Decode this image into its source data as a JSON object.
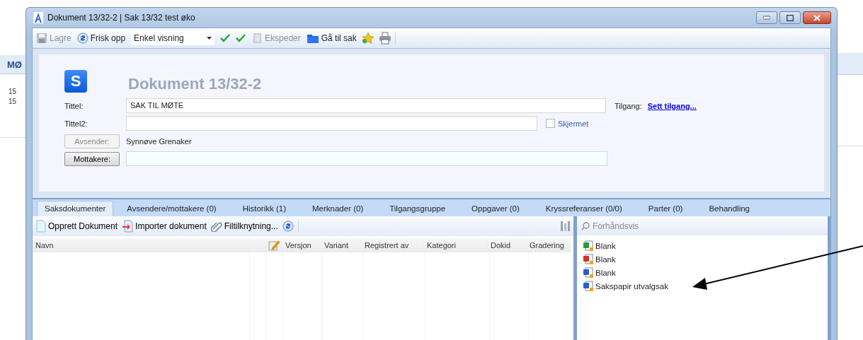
{
  "background_app": {
    "heading": "MØ",
    "lines": [
      "15",
      "15"
    ]
  },
  "window": {
    "title": "Dokument 13/32-2 | Sak 13/32 test øko"
  },
  "toolbar": [
    {
      "kind": "save",
      "label": "Lagre",
      "disabled": true
    },
    {
      "kind": "refresh",
      "label": "Frisk opp",
      "disabled": false
    },
    {
      "kind": "dropdown",
      "value": "Enkel visning"
    },
    {
      "kind": "check"
    },
    {
      "kind": "check"
    },
    {
      "kind": "send",
      "label": "Ekspeder",
      "disabled": true
    },
    {
      "kind": "folder",
      "label": "Gå til sak",
      "disabled": false
    },
    {
      "kind": "star"
    },
    {
      "kind": "print"
    }
  ],
  "form": {
    "heading": "Dokument 13/32-2",
    "badge": "S",
    "title": {
      "label": "Tittel:",
      "value": "SAK TIL MØTE"
    },
    "access": {
      "label": "Tilgang:",
      "link": "Sett tilgang..."
    },
    "title2": {
      "label": "Tittel2:"
    },
    "shielded": {
      "label": "Skjermet",
      "checked": false
    },
    "sender": {
      "button": "Avsender:",
      "disabled": true,
      "value": "Synnøve Grenaker"
    },
    "recipients": {
      "button": "Mottakere:",
      "disabled": false
    }
  },
  "tabs": [
    {
      "label": "Saksdokumenter",
      "selected": true
    },
    {
      "label": "Avsendere/mottakere (0)",
      "selected": false
    },
    {
      "label": "Historikk (1)",
      "selected": false
    },
    {
      "label": "Merknader (0)",
      "selected": false
    },
    {
      "label": "Tilgangsgruppe",
      "selected": false
    },
    {
      "label": "Oppgaver (0)",
      "selected": false
    },
    {
      "label": "Kryssreferanser (0/0)",
      "selected": false
    },
    {
      "label": "Parter (0)",
      "selected": false
    },
    {
      "label": "Behandling",
      "selected": false
    }
  ],
  "documents_toolbar": [
    {
      "kind": "new",
      "label": "Opprett Dokument"
    },
    {
      "kind": "import",
      "label": "Importer dokument"
    },
    {
      "kind": "link",
      "label": "Filtilknytning..."
    },
    {
      "kind": "refresh"
    }
  ],
  "table": {
    "columns": [
      {
        "kind": "text",
        "label": "Navn"
      },
      {
        "kind": "blank"
      },
      {
        "kind": "icon"
      },
      {
        "kind": "text",
        "label": "Versjon"
      },
      {
        "kind": "text",
        "label": "Variant"
      },
      {
        "kind": "text",
        "label": "Registrert av"
      },
      {
        "kind": "text",
        "label": "Kategori"
      },
      {
        "kind": "text",
        "label": "Dokid"
      },
      {
        "kind": "text",
        "label": "Gradering"
      }
    ]
  },
  "preview": {
    "placeholder": "Forhåndsvis",
    "items": [
      {
        "kind": "excel",
        "label": "Blank"
      },
      {
        "kind": "pdf",
        "label": "Blank"
      },
      {
        "kind": "word",
        "label": "Blank"
      },
      {
        "kind": "word",
        "label": "Sakspapir utvalgsak"
      }
    ]
  }
}
